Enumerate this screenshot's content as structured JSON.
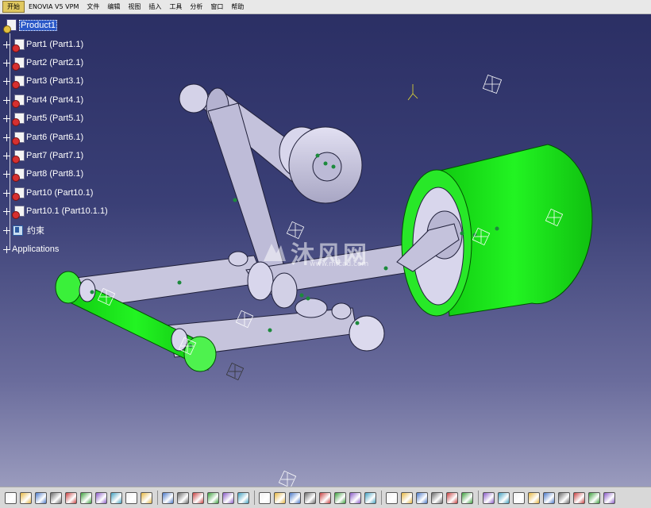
{
  "menubar": {
    "items": [
      "开始",
      "ENOVIA V5 VPM",
      "文件",
      "编辑",
      "视图",
      "插入",
      "工具",
      "分析",
      "窗口",
      "帮助"
    ]
  },
  "tree": {
    "root_label": "Product1",
    "parts": [
      "Part1 (Part1.1)",
      "Part2 (Part2.1)",
      "Part3 (Part3.1)",
      "Part4 (Part4.1)",
      "Part5 (Part5.1)",
      "Part6 (Part6.1)",
      "Part7 (Part7.1)",
      "Part8 (Part8.1)",
      "Part10 (Part10.1)",
      "Part10.1 (Part10.1.1)"
    ],
    "constraints_label": "约束",
    "applications_label": "Applications"
  },
  "watermark": {
    "text": "沐风网",
    "subtext": "www.mfcad.com"
  },
  "toolbar": {
    "icons": [
      "new-icon",
      "open-icon",
      "save-icon",
      "print-icon",
      "cut-icon",
      "copy-icon",
      "paste-icon",
      "undo-icon",
      "redo-icon",
      "help-icon",
      "formula-icon",
      "comment-icon",
      "table-icon",
      "tree-icon",
      "catalog-icon",
      "macro-icon",
      "fly-icon",
      "fit-all-icon",
      "pan-icon",
      "rotate-icon",
      "zoom-in-icon",
      "zoom-out-icon",
      "normal-view-icon",
      "multi-view-icon",
      "iso-view-icon",
      "shading-icon",
      "hide-show-icon",
      "swap-icon",
      "measure-icon",
      "compass-icon",
      "render-icon",
      "capture-icon",
      "assembly-icon",
      "snap-icon",
      "constraint-icon",
      "sketch-icon",
      "apply-material-icon",
      "update-icon",
      "more-icon"
    ],
    "colors": {
      "green": "#00ee00",
      "part_gray": "#c8c6de",
      "selection_blue": "#2a58c8"
    }
  }
}
